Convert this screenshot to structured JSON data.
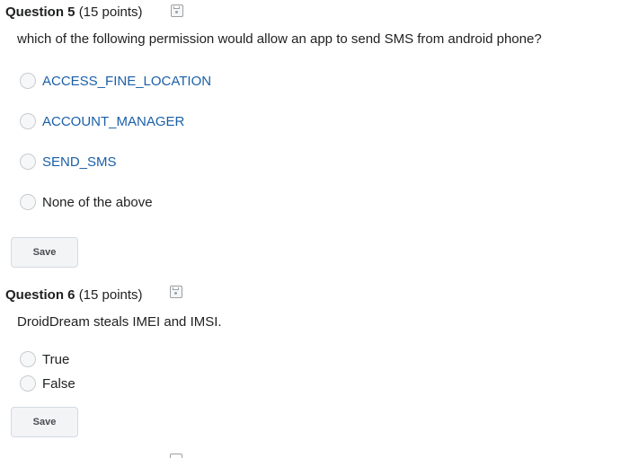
{
  "questions": [
    {
      "number_label": "Question 5",
      "points": "(15 points)",
      "prompt": "which of the following permission would allow an app to send SMS from android phone?",
      "options": [
        "ACCESS_FINE_LOCATION",
        "ACCOUNT_MANAGER",
        "SEND_SMS",
        "None of the above"
      ],
      "save_label": "Save",
      "save_icon": "floppy-disk-icon"
    },
    {
      "number_label": "Question 6",
      "points": "(15 points)",
      "prompt": "DroidDream steals IMEI and IMSI.",
      "options": [
        "True",
        "False"
      ],
      "save_label": "Save",
      "save_icon": "floppy-disk-icon"
    }
  ],
  "colors": {
    "link_option": "#1a5fa8",
    "text": "#202122"
  }
}
